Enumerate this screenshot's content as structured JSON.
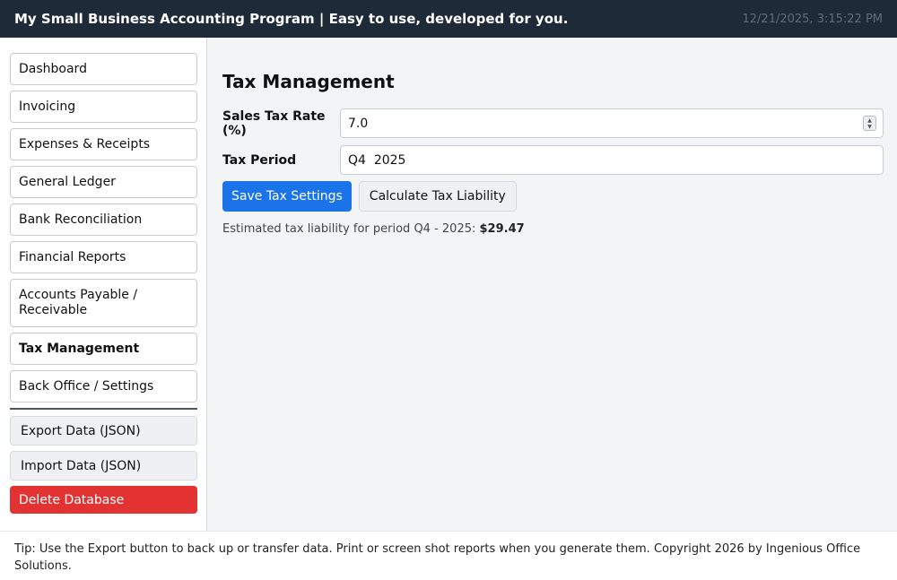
{
  "header": {
    "title": "My Small Business Accounting Program | Easy to use, developed for you.",
    "datetime": "12/21/2025, 3:15:22 PM"
  },
  "sidebar": {
    "items": [
      {
        "label": "Dashboard"
      },
      {
        "label": "Invoicing"
      },
      {
        "label": "Expenses & Receipts"
      },
      {
        "label": "General Ledger"
      },
      {
        "label": "Bank Reconciliation"
      },
      {
        "label": "Financial Reports"
      },
      {
        "label": "Accounts Payable / Receivable"
      },
      {
        "label": "Tax Management"
      },
      {
        "label": "Back Office / Settings"
      }
    ],
    "active": "Tax Management",
    "export_label": "Export Data (JSON)",
    "import_label": "Import Data (JSON)",
    "delete_label": "Delete Database",
    "delete_color": "#e23232"
  },
  "main": {
    "title": "Tax Management",
    "sales_tax_label": "Sales Tax Rate (%)",
    "sales_tax_value": "7.0",
    "tax_period_label": "Tax Period",
    "tax_period_value": "Q4  2025",
    "save_button": "Save Tax Settings",
    "calculate_button": "Calculate Tax Liability",
    "result_prefix": "Estimated tax liability for period Q4 - 2025: ",
    "result_amount": "$29.47",
    "accent_color": "#1a73e8"
  },
  "footer": {
    "text": "Tip: Use the Export button to back up or transfer data. Print or screen shot reports when you generate them. Copyright 2026 by Ingenious Office Solutions."
  }
}
